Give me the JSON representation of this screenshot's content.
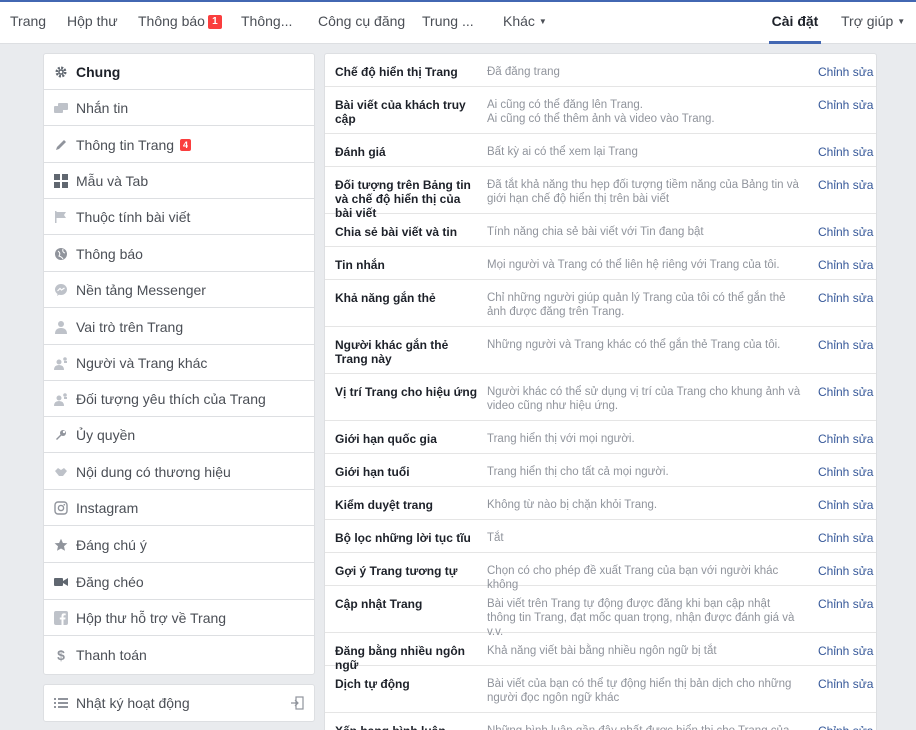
{
  "topnav": {
    "items": [
      {
        "label": "Trang"
      },
      {
        "label": "Hộp thư"
      },
      {
        "label": "Thông báo",
        "badge": "1"
      },
      {
        "label": "Thông..."
      },
      {
        "label": "Công cụ đăng"
      },
      {
        "label": "Trung ..."
      },
      {
        "label": "Khác"
      },
      {
        "label": "Cài đặt"
      },
      {
        "label": "Trợ giúp"
      }
    ]
  },
  "sidebar": {
    "items": [
      {
        "label": "Chung",
        "icon": "gear-icon"
      },
      {
        "label": "Nhắn tin",
        "icon": "message-icon"
      },
      {
        "label": "Thông tin Trang",
        "icon": "pencil-icon",
        "badge": "4"
      },
      {
        "label": "Mẫu và Tab",
        "icon": "grid-icon"
      },
      {
        "label": "Thuộc tính bài viết",
        "icon": "flag-icon"
      },
      {
        "label": "Thông báo",
        "icon": "globe-icon"
      },
      {
        "label": "Nền tảng Messenger",
        "icon": "messenger-icon"
      },
      {
        "label": "Vai trò trên Trang",
        "icon": "person-icon"
      },
      {
        "label": "Người và Trang khác",
        "icon": "people-icon"
      },
      {
        "label": "Đối tượng yêu thích của Trang",
        "icon": "people-star-icon"
      },
      {
        "label": "Ủy quyền",
        "icon": "wrench-icon"
      },
      {
        "label": "Nội dung có thương hiệu",
        "icon": "handshake-icon"
      },
      {
        "label": "Instagram",
        "icon": "instagram-icon"
      },
      {
        "label": "Đáng chú ý",
        "icon": "star-icon"
      },
      {
        "label": "Đăng chéo",
        "icon": "video-icon"
      },
      {
        "label": "Hộp thư hỗ trợ về Trang",
        "icon": "facebook-icon"
      },
      {
        "label": "Thanh toán",
        "icon": "dollar-icon"
      }
    ],
    "activity_log": {
      "label": "Nhật ký hoạt động",
      "icon": "list-icon"
    }
  },
  "settings": {
    "edit_label": "Chỉnh sửa",
    "rows": [
      {
        "label": "Chế độ hiển thị Trang",
        "value": "Đã đăng trang"
      },
      {
        "label": "Bài viết của khách truy cập",
        "value": "Ai cũng có thể đăng lên Trang.\nAi cũng có thể thêm ảnh và video vào Trang."
      },
      {
        "label": "Đánh giá",
        "value": "Bất kỳ ai có thể xem lại Trang"
      },
      {
        "label": "Đối tượng trên Bảng tin và chế độ hiển thị của bài viết",
        "value": "Đã tắt khả năng thu hẹp đối tượng tiềm năng của Bảng tin và giới hạn chế độ hiển thị trên bài viết"
      },
      {
        "label": "Chia sẻ bài viết và tin",
        "value": "Tính năng chia sẻ bài viết với Tin đang bật"
      },
      {
        "label": "Tin nhắn",
        "value": "Mọi người và Trang có thể liên hệ riêng với Trang của tôi."
      },
      {
        "label": "Khả năng gắn thẻ",
        "value": "Chỉ những người giúp quản lý Trang của tôi có thể gắn thẻ ảnh được đăng trên Trang."
      },
      {
        "label": "Người khác gắn thẻ Trang này",
        "value": "Những người và Trang khác có thể gắn thẻ Trang của tôi."
      },
      {
        "label": "Vị trí Trang cho hiệu ứng",
        "value": "Người khác có thể sử dụng vị trí của Trang cho khung ảnh và video cũng như hiệu ứng."
      },
      {
        "label": "Giới hạn quốc gia",
        "value": "Trang hiển thị với mọi người."
      },
      {
        "label": "Giới hạn tuổi",
        "value": "Trang hiển thị cho tất cả mọi người."
      },
      {
        "label": "Kiểm duyệt trang",
        "value": "Không từ nào bị chặn khỏi Trang."
      },
      {
        "label": "Bộ lọc những lời tục tĩu",
        "value": "Tắt"
      },
      {
        "label": "Gợi ý Trang tương tự",
        "value": "Chọn có cho phép đề xuất Trang của bạn với người khác không"
      },
      {
        "label": "Cập nhật Trang",
        "value": "Bài viết trên Trang tự động được đăng khi bạn cập nhật thông tin Trang, đạt mốc quan trọng, nhận được đánh giá và v.v."
      },
      {
        "label": "Đăng bằng nhiều ngôn ngữ",
        "value": "Khả năng viết bài bằng nhiều ngôn ngữ bị tắt"
      },
      {
        "label": "Dịch tự động",
        "value": "Bài viết của bạn có thể tự động hiển thị bản dịch cho những người đọc ngôn ngữ khác"
      },
      {
        "label": "Xếp hạng bình luận",
        "value": "Những bình luận gần đây nhất được hiển thị cho Trang của tôi"
      }
    ]
  }
}
